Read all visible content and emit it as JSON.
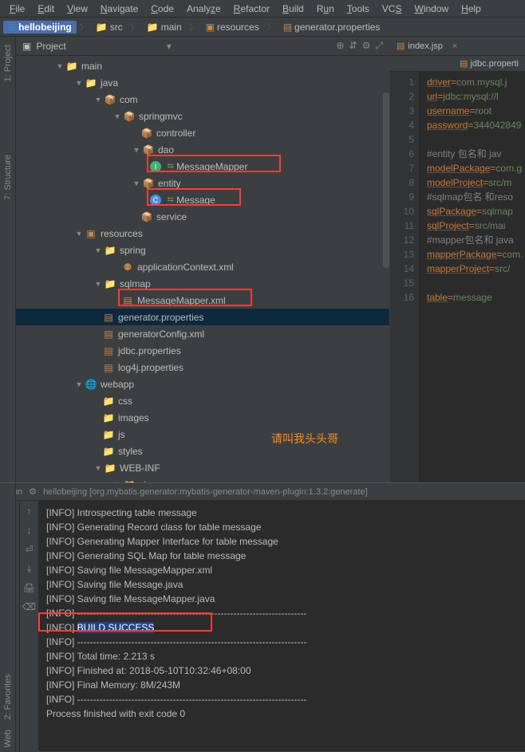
{
  "menu": {
    "file": "File",
    "edit": "Edit",
    "view": "View",
    "navigate": "Navigate",
    "code": "Code",
    "analyze": "Analyze",
    "refactor": "Refactor",
    "build": "Build",
    "run": "Run",
    "tools": "Tools",
    "vcs": "VCS",
    "window": "Window",
    "help": "Help"
  },
  "breadcrumb": {
    "project": "hellobeijing",
    "p1": "src",
    "p2": "main",
    "p3": "resources",
    "p4": "generator.properties"
  },
  "project_panel": {
    "title": "Project"
  },
  "sidebar_tabs": {
    "project": "1: Project",
    "structure": "7: Structure",
    "favorites": "2: Favorites",
    "web": "Web"
  },
  "tree": {
    "main": "main",
    "java": "java",
    "com": "com",
    "springmvc": "springmvc",
    "controller": "controller",
    "dao": "dao",
    "message_mapper": "MessageMapper",
    "entity": "entity",
    "message": "Message",
    "service": "service",
    "resources": "resources",
    "spring": "spring",
    "app_ctx": "applicationContext.xml",
    "sqlmap": "sqlmap",
    "msg_mapper_xml": "MessageMapper.xml",
    "gen_props": "generator.properties",
    "gen_config": "generatorConfig.xml",
    "jdbc_props": "jdbc.properties",
    "log4j": "log4j.properties",
    "webapp": "webapp",
    "css": "css",
    "images": "images",
    "js": "js",
    "styles": "styles",
    "webinf": "WEB-INF",
    "views": "views"
  },
  "watermark": "请叫我头头哥",
  "editor": {
    "tab1": "index.jsp",
    "tab2": "jdbc.properti",
    "lines": {
      "l1_k": "driver",
      "l1_v": "com.mysql.j",
      "l2_k": "url",
      "l2_v": "jdbc:mysql://l",
      "l3_k": "username",
      "l3_v": "root",
      "l4_k": "password",
      "l4_v": "344042849",
      "l6": "#entity 包名和 jav",
      "l7_k": "modelPackage",
      "l7_v": "com.g",
      "l8_k": "modelProject",
      "l8_v": "src/m",
      "l9": "#sqlmap包名 和reso",
      "l10_k": "sqlPackage",
      "l10_v": "sqlmap",
      "l11_k": "sqlProject",
      "l11_v": "src/mai",
      "l12": "#mapper包名和 java",
      "l13_k": "mapperPackage",
      "l13_v": "com.",
      "l14_k": "mapperProject",
      "l14_v": "src/",
      "l16_k": "table",
      "l16_v": "message"
    }
  },
  "run": {
    "label": "Run",
    "gear": "⚙",
    "title": "hellobeijing [org.mybatis.generator:mybatis-generator-maven-plugin:1.3.2:generate]",
    "lines": {
      "l1": "[INFO] Introspecting table message",
      "l2": "[INFO] Generating Record class for table message",
      "l3": "[INFO] Generating Mapper Interface for table message",
      "l4": "[INFO] Generating SQL Map for table message",
      "l5": "[INFO] Saving file MessageMapper.xml",
      "l6": "[INFO] Saving file Message.java",
      "l7": "[INFO] Saving file MessageMapper.java",
      "l8": "[INFO] ------------------------------------------------------------------------",
      "l9a": "[INFO] ",
      "l9b": "BUILD SUCCESS",
      "l10": "[INFO] ------------------------------------------------------------------------",
      "l11": "[INFO] Total time: 2.213 s",
      "l12": "[INFO] Finished at: 2018-05-10T10:32:46+08:00",
      "l13": "[INFO] Final Memory: 8M/243M",
      "l14": "[INFO] ------------------------------------------------------------------------",
      "l15": "",
      "l16": "Process finished with exit code 0"
    }
  }
}
